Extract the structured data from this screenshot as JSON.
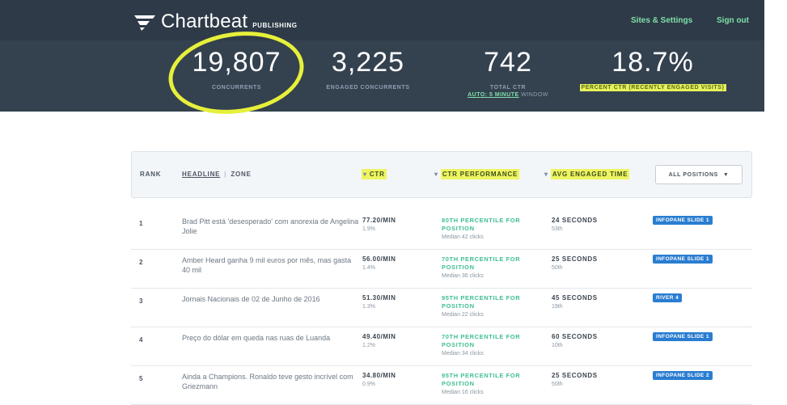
{
  "app": {
    "brand": "Chartbeat",
    "product": "PUBLISHING",
    "nav": [
      "Sites & Settings",
      "Sign out"
    ]
  },
  "stats": {
    "concurrents": {
      "value": "19,807",
      "label": "CONCURRENTS"
    },
    "engaged": {
      "value": "3,225",
      "label": "ENGAGED CONCURRENTS"
    },
    "total_ctr": {
      "value": "742",
      "label": "TOTAL CTR",
      "window_link": "AUTO: 5 MINUTE",
      "window_suffix": "WINDOW"
    },
    "percent_ctr": {
      "value": "18.7%",
      "label": "PERCENT CTR (RECENTLY ENGAGED VISITS)"
    }
  },
  "table": {
    "columns": {
      "rank": "RANK",
      "headline": "HEADLINE",
      "zone": "ZONE",
      "ctr": "CTR",
      "ctr_performance": "CTR PERFORMANCE",
      "avg_engaged_time": "AVG ENGAGED TIME"
    },
    "positions_dropdown": "ALL POSITIONS",
    "rows": [
      {
        "rank": "1",
        "headline": "Brad Pitt está 'desesperado' com anorexia de Angelina Jolie",
        "ctr": "77.20/MIN",
        "ctr_pct": "1.9%",
        "perf": "80TH PERCENTILE FOR POSITION",
        "median": "Median 42 clicks",
        "time": "24 SECONDS",
        "time_pct": "53th",
        "zone": "INFOPANE SLIDE 1"
      },
      {
        "rank": "2",
        "headline": "Amber Heard ganha 9 mil euros por mês, mas gasta 40 mil",
        "ctr": "56.00/MIN",
        "ctr_pct": "1.4%",
        "perf": "70TH PERCENTILE FOR POSITION",
        "median": "Median 36 clicks",
        "time": "25 SECONDS",
        "time_pct": "50th",
        "zone": "INFOPANE SLIDE 1"
      },
      {
        "rank": "3",
        "headline": "Jornais Nacionais de 02 de Junho de 2016",
        "ctr": "51.30/MIN",
        "ctr_pct": "1.3%",
        "perf": "95TH PERCENTILE FOR POSITION",
        "median": "Median 22 clicks",
        "time": "45 SECONDS",
        "time_pct": "19th",
        "zone": "RIVER 4"
      },
      {
        "rank": "4",
        "headline": "Preço do dólar em queda nas ruas de Luanda",
        "ctr": "49.40/MIN",
        "ctr_pct": "1.2%",
        "perf": "70TH PERCENTILE FOR POSITION",
        "median": "Median 34 clicks",
        "time": "60 SECONDS",
        "time_pct": "10th",
        "zone": "INFOPANE SLIDE 1"
      },
      {
        "rank": "5",
        "headline": "Ainda a Champions. Ronaldo teve gesto incrível com Griezmann",
        "ctr": "34.80/MIN",
        "ctr_pct": "0.9%",
        "perf": "95TH PERCENTILE FOR POSITION",
        "median": "Median 16 clicks",
        "time": "25 SECONDS",
        "time_pct": "50th",
        "zone": "INFOPANE SLIDE 2"
      }
    ]
  },
  "colors": {
    "header_bg": "#34414f",
    "accent_green": "#3fbf8f",
    "highlight": "#e5f25a",
    "badge_blue": "#2a7dd1"
  }
}
